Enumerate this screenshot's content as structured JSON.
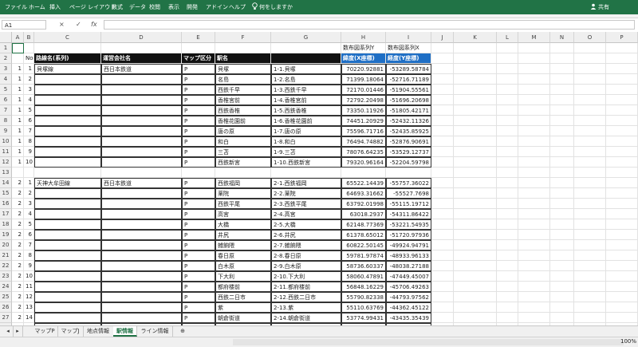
{
  "ribbon": {
    "tabs": [
      "ファイル",
      "ホーム",
      "挿入",
      "ページ レイアウト",
      "数式",
      "データ",
      "校閲",
      "表示",
      "開発",
      "アドイン",
      "ヘルプ"
    ],
    "tell_me": "何をしますか",
    "user": "共有"
  },
  "formula_bar": {
    "name_box": "A1",
    "cancel": "×",
    "enter": "✓",
    "fx": "fx"
  },
  "columns": [
    "A",
    "B",
    "C",
    "D",
    "E",
    "F",
    "G",
    "H",
    "I",
    "J",
    "K",
    "L",
    "M",
    "N",
    "O",
    "P"
  ],
  "row_numbers": [
    "1",
    "2",
    "3",
    "4",
    "5",
    "6",
    "7",
    "8",
    "9",
    "10",
    "11",
    "12",
    "13",
    "14",
    "15",
    "16",
    "17",
    "18",
    "19",
    "20",
    "21",
    "22",
    "23",
    "24",
    "25",
    "26",
    "27",
    "28"
  ],
  "header_row1": {
    "h": "数布図系列Y",
    "i": "数布図系列X"
  },
  "header_row2": {
    "b": "No",
    "c": "路線名(系列)",
    "d": "運営会社名",
    "e": "マップ区分",
    "f": "駅名",
    "h": "緯度(X座標)",
    "i": "経度(Y座標)"
  },
  "rows": [
    {
      "a": "1",
      "b": "1",
      "c": "貝塚線",
      "d": "西日本鉄道",
      "e": "P",
      "f": "貝塚",
      "g": "1-1.貝塚",
      "h": "70220.92881",
      "i": "-53289.58784"
    },
    {
      "a": "1",
      "b": "2",
      "c": "",
      "d": "",
      "e": "P",
      "f": "名島",
      "g": "1-2.名島",
      "h": "71399.18064",
      "i": "-52716.71189"
    },
    {
      "a": "1",
      "b": "3",
      "c": "",
      "d": "",
      "e": "P",
      "f": "西鉄千早",
      "g": "1-3.西鉄千早",
      "h": "72170.01446",
      "i": "-51904.55561"
    },
    {
      "a": "1",
      "b": "4",
      "c": "",
      "d": "",
      "e": "P",
      "f": "香椎宮前",
      "g": "1-4.香椎宮前",
      "h": "72792.20498",
      "i": "-51696.20698"
    },
    {
      "a": "1",
      "b": "5",
      "c": "",
      "d": "",
      "e": "P",
      "f": "西鉄香椎",
      "g": "1-5.西鉄香椎",
      "h": "73350.11926",
      "i": "-51805.42171"
    },
    {
      "a": "1",
      "b": "6",
      "c": "",
      "d": "",
      "e": "P",
      "f": "香椎花園前",
      "g": "1-6.香椎花園前",
      "h": "74451.20929",
      "i": "-52432.11326"
    },
    {
      "a": "1",
      "b": "7",
      "c": "",
      "d": "",
      "e": "P",
      "f": "唐の原",
      "g": "1-7.唐の原",
      "h": "75596.71716",
      "i": "-52435.85925"
    },
    {
      "a": "1",
      "b": "8",
      "c": "",
      "d": "",
      "e": "P",
      "f": "和白",
      "g": "1-8.和白",
      "h": "76494.74882",
      "i": "-52876.90691"
    },
    {
      "a": "1",
      "b": "9",
      "c": "",
      "d": "",
      "e": "P",
      "f": "三苫",
      "g": "1-9.三苫",
      "h": "78076.64235",
      "i": "-53529.12737"
    },
    {
      "a": "1",
      "b": "10",
      "c": "",
      "d": "",
      "e": "P",
      "f": "西鉄新宮",
      "g": "1-10.西鉄新宮",
      "h": "79320.96164",
      "i": "-52204.59798"
    },
    {
      "a": "",
      "b": "",
      "c": "",
      "d": "",
      "e": "",
      "f": "",
      "g": "",
      "h": "",
      "i": ""
    },
    {
      "a": "2",
      "b": "1",
      "c": "天神大牟田線",
      "d": "西日本鉄道",
      "e": "P",
      "f": "西鉄福岡",
      "g": "2-1.西鉄福岡",
      "h": "65522.14439",
      "i": "-55757.36022"
    },
    {
      "a": "2",
      "b": "2",
      "c": "",
      "d": "",
      "e": "P",
      "f": "薬院",
      "g": "2-2.薬院",
      "h": "64693.31662",
      "i": "-55527.7698"
    },
    {
      "a": "2",
      "b": "3",
      "c": "",
      "d": "",
      "e": "P",
      "f": "西鉄平尾",
      "g": "2-3.西鉄平尾",
      "h": "63792.01998",
      "i": "-55115.19712"
    },
    {
      "a": "2",
      "b": "4",
      "c": "",
      "d": "",
      "e": "P",
      "f": "高宮",
      "g": "2-4.高宮",
      "h": "63018.2937",
      "i": "-54311.86422"
    },
    {
      "a": "2",
      "b": "5",
      "c": "",
      "d": "",
      "e": "P",
      "f": "大橋",
      "g": "2-5.大橋",
      "h": "62148.77369",
      "i": "-53221.54935"
    },
    {
      "a": "2",
      "b": "6",
      "c": "",
      "d": "",
      "e": "P",
      "f": "井尻",
      "g": "2-6.井尻",
      "h": "61378.65012",
      "i": "-51720.97936"
    },
    {
      "a": "2",
      "b": "7",
      "c": "",
      "d": "",
      "e": "P",
      "f": "雑餉隈",
      "g": "2-7.雑餉隈",
      "h": "60822.50145",
      "i": "-49924.94791"
    },
    {
      "a": "2",
      "b": "8",
      "c": "",
      "d": "",
      "e": "P",
      "f": "春日原",
      "g": "2-8.春日原",
      "h": "59781.97874",
      "i": "-48933.96133"
    },
    {
      "a": "2",
      "b": "9",
      "c": "",
      "d": "",
      "e": "P",
      "f": "白木原",
      "g": "2-9.白木原",
      "h": "58736.60337",
      "i": "-48038.27188"
    },
    {
      "a": "2",
      "b": "10",
      "c": "",
      "d": "",
      "e": "P",
      "f": "下大利",
      "g": "2-10.下大利",
      "h": "58060.47891",
      "i": "-47449.45007"
    },
    {
      "a": "2",
      "b": "11",
      "c": "",
      "d": "",
      "e": "P",
      "f": "都府楼前",
      "g": "2-11.都府楼前",
      "h": "56848.16229",
      "i": "-45706.49263"
    },
    {
      "a": "2",
      "b": "12",
      "c": "",
      "d": "",
      "e": "P",
      "f": "西鉄二日市",
      "g": "2-12.西鉄二日市",
      "h": "55790.82338",
      "i": "-44793.97562"
    },
    {
      "a": "2",
      "b": "13",
      "c": "",
      "d": "",
      "e": "P",
      "f": "紫",
      "g": "2-13.紫",
      "h": "55110.63769",
      "i": "-44362.45122"
    },
    {
      "a": "2",
      "b": "14",
      "c": "",
      "d": "",
      "e": "P",
      "f": "朝倉街道",
      "g": "2-14.朝倉街道",
      "h": "53774.99431",
      "i": "-43435.35439"
    },
    {
      "a": "2",
      "b": "15",
      "c": "",
      "d": "",
      "e": "P",
      "f": "桜台",
      "g": "2-15.桜台",
      "h": "52394.62441",
      "i": "-42529.7596"
    }
  ],
  "sheet_tabs": [
    "マップP",
    "マップJ",
    "地点情報",
    "駅情報",
    "ライン情報"
  ],
  "active_sheet": "駅情報",
  "add_sheet": "⊕",
  "zoom": "100%",
  "colors": {
    "excel_green": "#217346",
    "header_blue": "#1f6fc5",
    "header_black": "#111111"
  }
}
